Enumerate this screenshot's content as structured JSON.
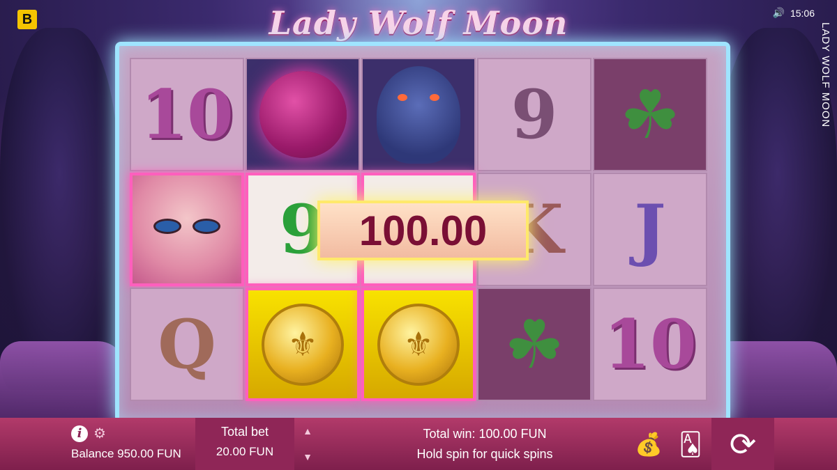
{
  "app": {
    "logo_letter": "B",
    "title": "Lady Wolf Moon",
    "vertical_title": "LADY WOLF MOON",
    "time": "15:06",
    "sound_icon": "speaker-icon"
  },
  "reels": [
    [
      {
        "symbol": "10",
        "type": "ten"
      },
      {
        "symbol": "lady",
        "type": "lady",
        "highlight": true
      },
      {
        "symbol": "Q",
        "type": "q"
      }
    ],
    [
      {
        "symbol": "moon",
        "type": "sphere"
      },
      {
        "symbol": "9",
        "type": "nine-green",
        "highlight": true
      },
      {
        "symbol": "coin",
        "type": "coin",
        "highlight": true
      }
    ],
    [
      {
        "symbol": "wolf",
        "type": "wolf"
      },
      {
        "symbol": "9",
        "type": "nine-green",
        "highlight": true
      },
      {
        "symbol": "coin",
        "type": "coin",
        "highlight": true
      }
    ],
    [
      {
        "symbol": "9",
        "type": "nine"
      },
      {
        "symbol": "K",
        "type": "k"
      },
      {
        "symbol": "clover",
        "type": "clover"
      }
    ],
    [
      {
        "symbol": "clover",
        "type": "clover"
      },
      {
        "symbol": "J",
        "type": "j"
      },
      {
        "symbol": "10",
        "type": "ten"
      }
    ]
  ],
  "win_popup": "100.00",
  "bottom_bar": {
    "info_icon": "i",
    "gear_icon": "gear-icon",
    "balance_label": "Balance",
    "balance_value": "950.00 FUN",
    "total_bet_label": "Total bet",
    "total_bet_value": "20.00 FUN",
    "total_win_label": "Total win:",
    "total_win_value": "100.00 FUN",
    "hint": "Hold spin for quick spins"
  }
}
